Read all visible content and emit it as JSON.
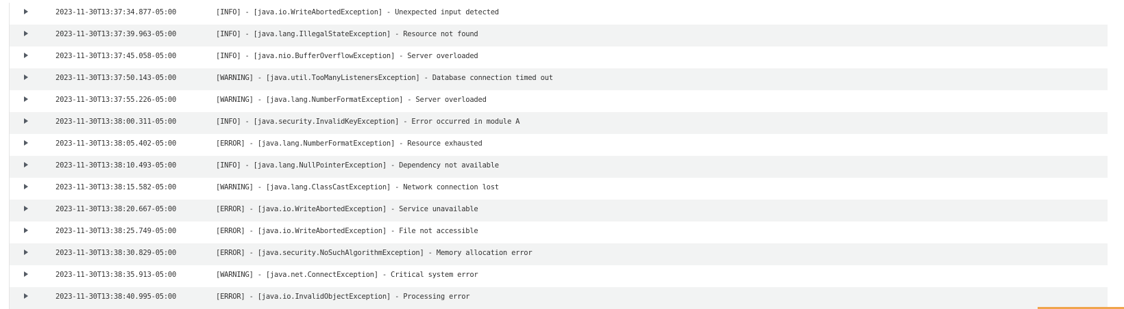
{
  "log": {
    "rows": [
      {
        "timestamp": "2023-11-30T13:37:34.877-05:00",
        "message": "[INFO] - [java.io.WriteAbortedException] - Unexpected input detected"
      },
      {
        "timestamp": "2023-11-30T13:37:39.963-05:00",
        "message": "[INFO] - [java.lang.IllegalStateException] - Resource not found"
      },
      {
        "timestamp": "2023-11-30T13:37:45.058-05:00",
        "message": "[INFO] - [java.nio.BufferOverflowException] - Server overloaded"
      },
      {
        "timestamp": "2023-11-30T13:37:50.143-05:00",
        "message": "[WARNING] - [java.util.TooManyListenersException] - Database connection timed out"
      },
      {
        "timestamp": "2023-11-30T13:37:55.226-05:00",
        "message": "[WARNING] - [java.lang.NumberFormatException] - Server overloaded"
      },
      {
        "timestamp": "2023-11-30T13:38:00.311-05:00",
        "message": "[INFO] - [java.security.InvalidKeyException] - Error occurred in module A"
      },
      {
        "timestamp": "2023-11-30T13:38:05.402-05:00",
        "message": "[ERROR] - [java.lang.NumberFormatException] - Resource exhausted"
      },
      {
        "timestamp": "2023-11-30T13:38:10.493-05:00",
        "message": "[INFO] - [java.lang.NullPointerException] - Dependency not available"
      },
      {
        "timestamp": "2023-11-30T13:38:15.582-05:00",
        "message": "[WARNING] - [java.lang.ClassCastException] - Network connection lost"
      },
      {
        "timestamp": "2023-11-30T13:38:20.667-05:00",
        "message": "[ERROR] - [java.io.WriteAbortedException] - Service unavailable"
      },
      {
        "timestamp": "2023-11-30T13:38:25.749-05:00",
        "message": "[ERROR] - [java.io.WriteAbortedException] - File not accessible"
      },
      {
        "timestamp": "2023-11-30T13:38:30.829-05:00",
        "message": "[ERROR] - [java.security.NoSuchAlgorithmException] - Memory allocation error"
      },
      {
        "timestamp": "2023-11-30T13:38:35.913-05:00",
        "message": "[WARNING] - [java.net.ConnectException] - Critical system error"
      },
      {
        "timestamp": "2023-11-30T13:38:40.995-05:00",
        "message": "[ERROR] - [java.io.InvalidObjectException] - Processing error"
      }
    ],
    "row_icon": "caret-right-icon"
  },
  "colors": {
    "row_alt": "#f2f3f3",
    "row": "#ffffff",
    "text": "#333333",
    "caret": "#545b64",
    "scroll_accent": "#f0a44b"
  }
}
